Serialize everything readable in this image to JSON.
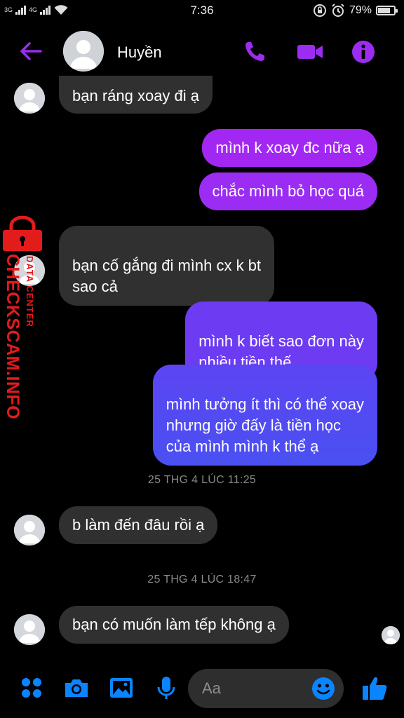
{
  "status_bar": {
    "network_1": "3G",
    "network_2": "4G",
    "time": "7:36",
    "battery": "79%",
    "battery_level": 0.79
  },
  "header": {
    "contact_name": "Huyền"
  },
  "messages": [
    {
      "side": "in",
      "text": "bạn ráng xoay đi ạ"
    },
    {
      "side": "out",
      "text": "mình k xoay đc nữa ạ"
    },
    {
      "side": "out",
      "text": "chắc mình bỏ học quá"
    },
    {
      "side": "in",
      "text": "bạn cố gắng đi mình cx k bt\nsao cả"
    },
    {
      "side": "out",
      "text": "mình k biết sao đơn này\nnhiều tiền thế"
    },
    {
      "side": "out",
      "text": "mình tưởng ít thì có thể xoay\nnhưng giờ đấy là tiền học\ncủa mình mình k thể ạ"
    },
    {
      "side": "in",
      "text": "b làm đến đâu rồi ạ"
    },
    {
      "side": "in",
      "text": "bạn có muốn làm tếp không ạ"
    }
  ],
  "timestamps": [
    "25 THG 4 LÚC 11:25",
    "25 THG 4 LÚC 18:47"
  ],
  "watermark": {
    "line1": "DATA CENTER",
    "line2": "CHECKSCAM.INFO"
  },
  "composer": {
    "placeholder": "Aa"
  },
  "colors": {
    "accent": "#9b2cf0",
    "bubble_in": "#303030",
    "bubble_out_top": "#a327f3",
    "bubble_out_bottom": "#4a4ff2",
    "icon_blue": "#0a84ff",
    "watermark_red": "#e21b1b"
  },
  "icons": {
    "back": "arrow-left-icon",
    "call": "phone-icon",
    "video": "video-camera-icon",
    "info": "info-icon",
    "apps": "grid-icon",
    "camera": "camera-icon",
    "gallery": "image-icon",
    "mic": "microphone-icon",
    "emoji": "smiley-icon",
    "like": "thumbs-up-icon"
  }
}
